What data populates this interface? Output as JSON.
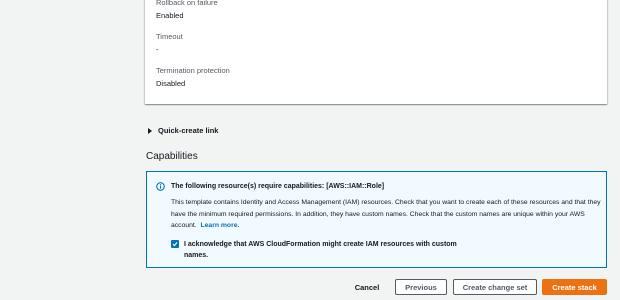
{
  "details": {
    "rollback": {
      "label": "Rollback on failure",
      "value": "Enabled"
    },
    "timeout": {
      "label": "Timeout",
      "value": "-"
    },
    "termination": {
      "label": "Termination protection",
      "value": "Disabled"
    }
  },
  "quick_create": {
    "label": "Quick-create link"
  },
  "capabilities": {
    "heading": "Capabilities",
    "alert": {
      "title": "The following resource(s) require capabilities: [AWS::IAM::Role]",
      "body": "This template contains Identity and Access Management (IAM) resources. Check that you want to create each of these resources and that they have the minimum required permissions. In addition, they have custom names. Check that the custom names are unique within your AWS account.",
      "learn_more": "Learn more.",
      "acknowledge": "I acknowledge that AWS CloudFormation might create IAM resources with custom names.",
      "acknowledged": true
    }
  },
  "footer": {
    "cancel": "Cancel",
    "previous": "Previous",
    "change_set": "Create change set",
    "create": "Create stack"
  },
  "colors": {
    "accent": "#0073bb",
    "primary_button": "#ec7211",
    "background": "#f2f3f3"
  }
}
